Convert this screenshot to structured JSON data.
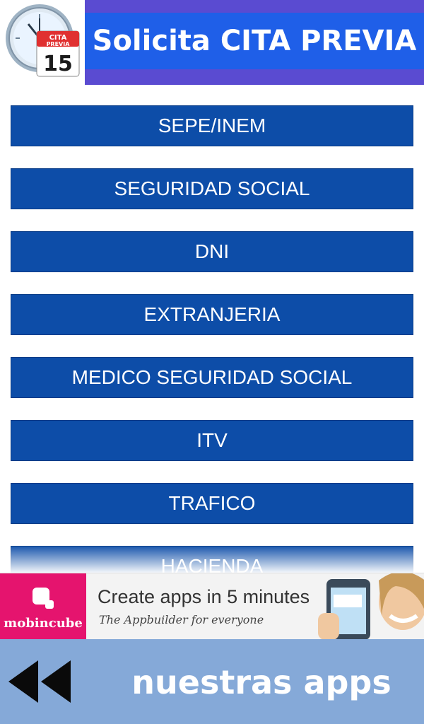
{
  "header": {
    "title": "Solicita CITA PREVIA",
    "logo": {
      "label_top": "CITA",
      "label_mid": "PREVIA",
      "day": "15"
    }
  },
  "menu": {
    "items": [
      {
        "label": "SEPE/INEM"
      },
      {
        "label": "SEGURIDAD SOCIAL"
      },
      {
        "label": "DNI"
      },
      {
        "label": "EXTRANJERIA"
      },
      {
        "label": "MEDICO SEGURIDAD SOCIAL"
      },
      {
        "label": "ITV"
      },
      {
        "label": "TRAFICO"
      },
      {
        "label": "HACIENDA"
      }
    ]
  },
  "ad": {
    "brand": "mobincube",
    "headline": "Create apps in 5 minutes",
    "subtitle": "The Appbuilder for everyone"
  },
  "bottom": {
    "apps_label": "nuestras apps"
  },
  "colors": {
    "button": "#0d4da8",
    "title_bg": "#1f5fe8",
    "title_border": "#5a4bd1",
    "bottom_bg": "#85a9d8",
    "ad_brand": "#e5146e"
  }
}
